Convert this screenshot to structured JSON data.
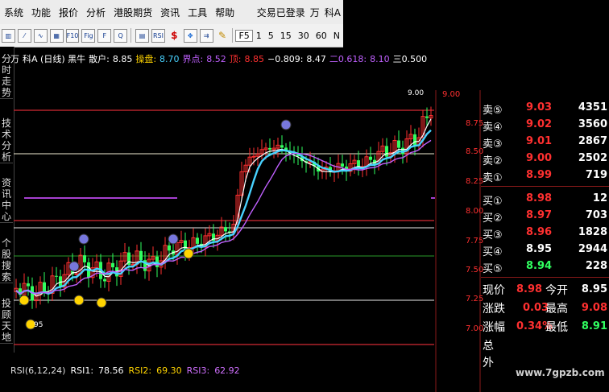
{
  "menu": {
    "items": [
      "系统",
      "功能",
      "报价",
      "分析",
      "港股期货",
      "资讯",
      "工具",
      "帮助"
    ],
    "status": "交易已登录",
    "user": "万",
    "stock_short": "科A"
  },
  "toolbar": {
    "icons": [
      "bar-chart-icon",
      "line-chart-icon",
      "candle-icon",
      "ranking-icon",
      "f10-icon",
      "fig-icon",
      "f10-alt-icon",
      "search-icon",
      "chart-grid-icon",
      "rsi-icon",
      "dollar-icon",
      "arrows-icon",
      "export-icon",
      "pen-icon"
    ],
    "icon_text": [
      "▥",
      "⁄",
      "∿",
      "▦",
      "F10",
      "Fig",
      "F",
      "Q",
      "▤",
      "RSI",
      "$",
      "✥",
      "⇉",
      "✎"
    ],
    "f5_label": "F5",
    "periods": [
      "1",
      "5",
      "15",
      "30",
      "60",
      "N"
    ]
  },
  "sidebar": {
    "tabs": [
      "分时走势",
      "技术分析",
      "资讯中心",
      "个股搜索",
      "投顾天地"
    ]
  },
  "chart_header": {
    "title_prefix": "万",
    "title": "科A (日线) 黑牛",
    "sanhu_label": "散户:",
    "sanhu_value": "8.85",
    "caopan_label": "操盘:",
    "caopan_value": "8.70",
    "jiedian_label": "界点:",
    "jiedian_value": "8.52",
    "ding_label": "顶:",
    "ding_value": "8.85",
    "minus_value": "−0.809:",
    "p2_value": "8.47",
    "fib_label": "二0.618:",
    "fib_value": "8.10",
    "three_label": "三0.500"
  },
  "chart_data": {
    "type": "candlestick",
    "y_ticks": [
      "9.00",
      "8.75",
      "8.50",
      "8.25",
      "8.00",
      "7.75",
      "7.50",
      "7.25",
      "7.00"
    ],
    "top_tick_label": "9.00",
    "low_label": "95",
    "ylim": [
      6.85,
      9.1
    ]
  },
  "rsi": {
    "label": "RSI(6,12,24)",
    "rsi1_label": "RSI1:",
    "rsi1_value": "78.56",
    "rsi2_label": "RSI2:",
    "rsi2_value": "69.30",
    "rsi3_label": "RSI3:",
    "rsi3_value": "62.92"
  },
  "quote": {
    "asks": [
      {
        "label": "卖⑤",
        "price": "9.03",
        "volume": "4351"
      },
      {
        "label": "卖④",
        "price": "9.02",
        "volume": "3560"
      },
      {
        "label": "卖③",
        "price": "9.01",
        "volume": "2867"
      },
      {
        "label": "卖②",
        "price": "9.00",
        "volume": "2502"
      },
      {
        "label": "卖①",
        "price": "8.99",
        "volume": "719"
      }
    ],
    "bids": [
      {
        "label": "买①",
        "price": "8.98",
        "volume": "12"
      },
      {
        "label": "买②",
        "price": "8.97",
        "volume": "703"
      },
      {
        "label": "买③",
        "price": "8.96",
        "volume": "1828"
      },
      {
        "label": "买④",
        "price": "8.95",
        "volume": "2944"
      },
      {
        "label": "买⑤",
        "price": "8.94",
        "volume": "228"
      }
    ],
    "xianjia_label": "现价",
    "xianjia_value": "8.98",
    "jinkai_label": "今开",
    "jinkai_value": "8.95",
    "zhangdie_label": "涨跌",
    "zhangdie_value": "0.03",
    "zuigao_label": "最高",
    "zuigao_value": "9.08",
    "zhangfu_label": "涨幅",
    "zhangfu_value": "0.34%",
    "zuidi_label": "最低",
    "zuidi_value": "8.91",
    "zong_label": "总",
    "wai_label": "外"
  },
  "colors": {
    "up": "#ff3030",
    "down": "#30ff60",
    "yellow": "#ffd400",
    "cyan": "#48d2ff",
    "purple": "#c060ff"
  },
  "watermark": "www.7gpzb.com"
}
